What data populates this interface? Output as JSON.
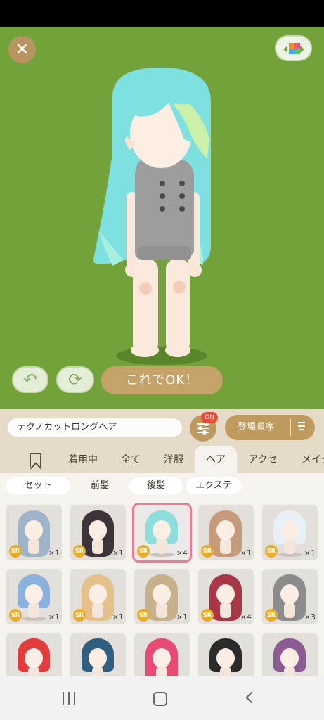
{
  "stage": {
    "bg_color": "#73a23a",
    "close_icon": "close-icon",
    "palette_icon": "color-palette-icon",
    "undo_icon": "undo-icon",
    "rotate_icon": "rotate-icon",
    "ok_label": "これでOK！"
  },
  "character": {
    "hair_color": "#7fe0e0",
    "outfit_color": "#9a9a9a"
  },
  "search": {
    "item_name": "テクノカットロングヘア",
    "filter_icon": "filter-sliders-icon",
    "filter_badge": "ON",
    "sort_label": "登場順序",
    "sort_icon": "sort-order-icon"
  },
  "categories": [
    {
      "label": "着用中"
    },
    {
      "label": "全て"
    },
    {
      "label": "洋服"
    },
    {
      "label": "ヘア"
    },
    {
      "label": "アクセ"
    },
    {
      "label": "メイク"
    }
  ],
  "subcategories": [
    {
      "label": "セット"
    },
    {
      "label": "前髪"
    },
    {
      "label": "後髪"
    },
    {
      "label": "エクステ"
    }
  ],
  "items": [
    {
      "rarity": "SR",
      "qty": "×1",
      "color": "#9fb4c8"
    },
    {
      "rarity": "SR",
      "qty": "×1",
      "color": "#3c3438"
    },
    {
      "rarity": "SR",
      "qty": "×4",
      "color": "#8fdede"
    },
    {
      "rarity": "SR",
      "qty": "×1",
      "color": "#c79a7c"
    },
    {
      "rarity": "SR",
      "qty": "×1",
      "color": "#e8f2f6"
    },
    {
      "rarity": "SR",
      "qty": "×1",
      "color": "#8bb1df"
    },
    {
      "rarity": "SR",
      "qty": "×1",
      "color": "#e6c08a"
    },
    {
      "rarity": "SR",
      "qty": "×1",
      "color": "#c8b08c"
    },
    {
      "rarity": "SR",
      "qty": "×4",
      "color": "#a83848"
    },
    {
      "rarity": "SR",
      "qty": "×3",
      "color": "#8c8c8c"
    },
    {
      "rarity": "",
      "qty": "",
      "color": "#e23c3c"
    },
    {
      "rarity": "",
      "qty": "",
      "color": "#2f5e7e"
    },
    {
      "rarity": "",
      "qty": "",
      "color": "#e84a74"
    },
    {
      "rarity": "",
      "qty": "",
      "color": "#2a2a2a"
    },
    {
      "rarity": "",
      "qty": "",
      "color": "#8a5a92"
    }
  ]
}
